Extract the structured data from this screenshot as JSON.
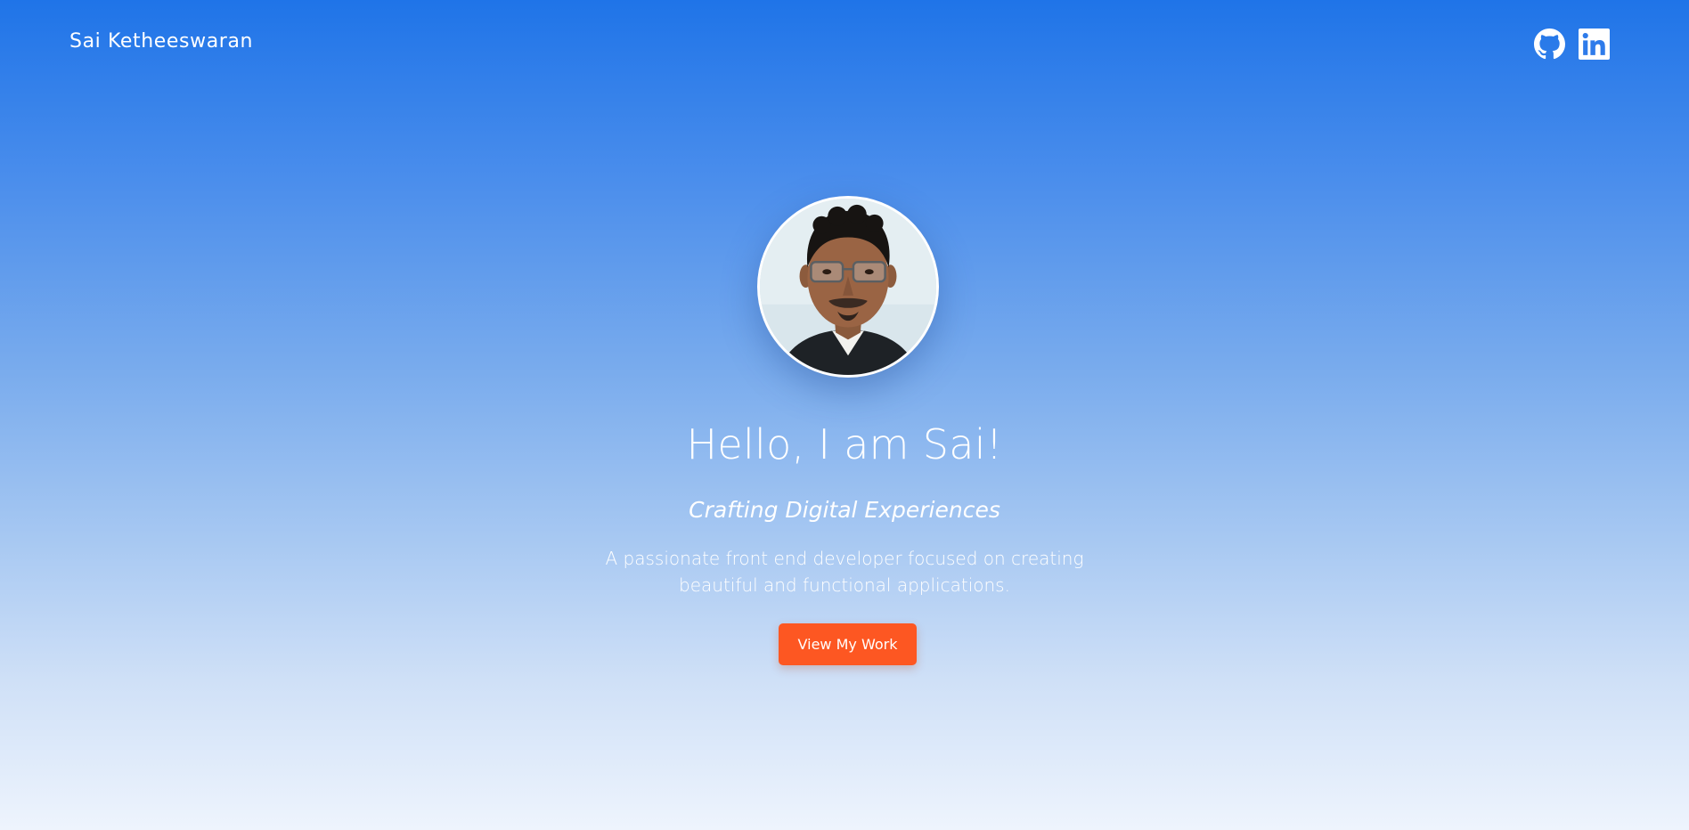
{
  "header": {
    "brand": "Sai Ketheeswaran",
    "social": [
      {
        "icon": "github-icon"
      },
      {
        "icon": "linkedin-icon"
      }
    ]
  },
  "hero": {
    "greeting": "Hello, I am Sai!",
    "tagline": "Crafting Digital Experiences",
    "description": "A passionate front end developer focused on creating beautiful and functional applications.",
    "cta_label": "View My Work"
  },
  "colors": {
    "gradient_top": "#1f74e8",
    "gradient_bottom": "#eef4fd",
    "accent": "#fd5722",
    "text": "#ffffff"
  }
}
